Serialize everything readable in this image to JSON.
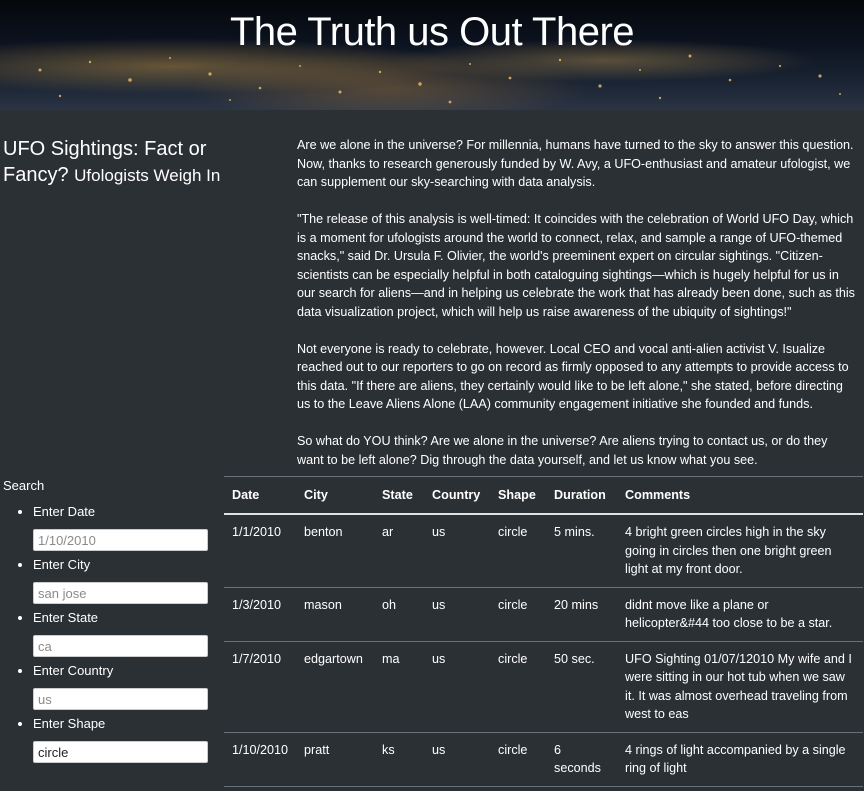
{
  "header": {
    "title": "The Truth us Out There"
  },
  "sidebar": {
    "title": "UFO Sightings: Fact or Fancy?",
    "subtitle": "Ufologists Weigh In"
  },
  "article": {
    "paragraphs": [
      "Are we alone in the universe? For millennia, humans have turned to the sky to answer this question. Now, thanks to research generously funded by W. Avy, a UFO-enthusiast and amateur ufologist, we can supplement our sky-searching with data analysis.",
      "\"The release of this analysis is well-timed: It coincides with the celebration of World UFO Day, which is a moment for ufologists around the world to connect, relax, and sample a range of UFO-themed snacks,\" said Dr. Ursula F. Olivier, the world's preeminent expert on circular sightings. \"Citizen-scientists can be especially helpful in both cataloguing sightings—which is hugely helpful for us in our search for aliens—and in helping us celebrate the work that has already been done, such as this data visualization project, which will help us raise awareness of the ubiquity of sightings!\"",
      "Not everyone is ready to celebrate, however. Local CEO and vocal anti-alien activist V. Isualize reached out to our reporters to go on record as firmly opposed to any attempts to provide access to this data. \"If there are aliens, they certainly would like to be left alone,\" she stated, before directing us to the Leave Aliens Alone (LAA) community engagement initiative she founded and funds.",
      "So what do YOU think? Are we alone in the universe? Are aliens trying to contact us, or do they want to be left alone? Dig through the data yourself, and let us know what you see."
    ]
  },
  "search": {
    "label": "Search",
    "filters": [
      {
        "label": "Enter Date",
        "placeholder": "1/10/2010",
        "value": ""
      },
      {
        "label": "Enter City",
        "placeholder": "san jose",
        "value": ""
      },
      {
        "label": "Enter State",
        "placeholder": "ca",
        "value": ""
      },
      {
        "label": "Enter Country",
        "placeholder": "us",
        "value": ""
      },
      {
        "label": "Enter Shape",
        "placeholder": "circle",
        "value": "circle"
      }
    ]
  },
  "table": {
    "columns": [
      "Date",
      "City",
      "State",
      "Country",
      "Shape",
      "Duration",
      "Comments"
    ],
    "rows": [
      [
        "1/1/2010",
        "benton",
        "ar",
        "us",
        "circle",
        "5 mins.",
        "4 bright green circles high in the sky going in circles then one bright green light at my front door."
      ],
      [
        "1/3/2010",
        "mason",
        "oh",
        "us",
        "circle",
        "20 mins",
        "didnt move like a plane or helicopter&#44 too close to be a star."
      ],
      [
        "1/7/2010",
        "edgartown",
        "ma",
        "us",
        "circle",
        "50 sec.",
        "UFO Sighting 01/07/12010 My wife and I were sitting in our hot tub when we saw it. It was almost overhead traveling from west to eas"
      ],
      [
        "1/10/2010",
        "pratt",
        "ks",
        "us",
        "circle",
        "6 seconds",
        "4 rings of light accompanied by a single ring of light"
      ]
    ]
  }
}
